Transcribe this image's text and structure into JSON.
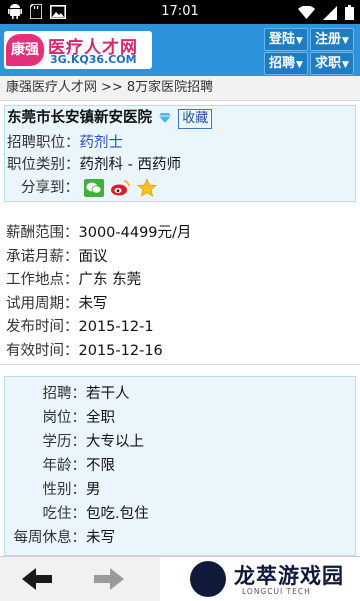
{
  "status_bar": {
    "time": "17:01"
  },
  "header": {
    "logo_badge": "康强",
    "logo_title": "医疗人才网",
    "logo_domain": "3G.KQ36.COM",
    "buttons": {
      "login": "登陆",
      "register": "注册",
      "recruit": "招聘",
      "jobseek": "求职"
    }
  },
  "breadcrumb": {
    "home": "康强医疗人才网",
    "sep": ">>",
    "current": "8万家医院招聘"
  },
  "job": {
    "hospital": "东莞市长安镇新安医院",
    "collect": "收藏",
    "position_label": "招聘职位：",
    "position": "药剂士",
    "category_label": "职位类别：",
    "category": "药剂科 - 西药师",
    "share_label": "分享到："
  },
  "details": [
    {
      "label": "薪酬范围：",
      "value": "3000-4499元/月"
    },
    {
      "label": "承诺月薪：",
      "value": "面议"
    },
    {
      "label": "工作地点：",
      "value": "广东 东莞"
    },
    {
      "label": "试用周期：",
      "value": "未写"
    },
    {
      "label": "发布时间：",
      "value": "2015-12-1"
    },
    {
      "label": "有效时间：",
      "value": "2015-12-16"
    }
  ],
  "requirements": [
    {
      "label": "招聘：",
      "value": "若干人"
    },
    {
      "label": "岗位：",
      "value": "全职"
    },
    {
      "label": "学历：",
      "value": "大专以上"
    },
    {
      "label": "年龄：",
      "value": "不限"
    },
    {
      "label": "性别：",
      "value": "男"
    },
    {
      "label": "吃住：",
      "value": "包吃.包住"
    },
    {
      "label": "每周休息：",
      "value": "未写"
    }
  ],
  "watermark": {
    "name": "龙萃游戏园",
    "sub": "LONGCUI TECH"
  },
  "colors": {
    "header_bg": "#2c93dc",
    "section_bg": "#eaf6fc",
    "link": "#2a4fc4",
    "brand_pink": "#d5266f"
  },
  "icons": [
    "android-icon",
    "sd-card-icon",
    "image-icon",
    "wifi-icon",
    "signal-icon",
    "battery-icon",
    "diamond-icon",
    "wechat-icon",
    "weibo-icon",
    "qzone-star-icon",
    "back-arrow-icon",
    "forward-arrow-icon"
  ]
}
